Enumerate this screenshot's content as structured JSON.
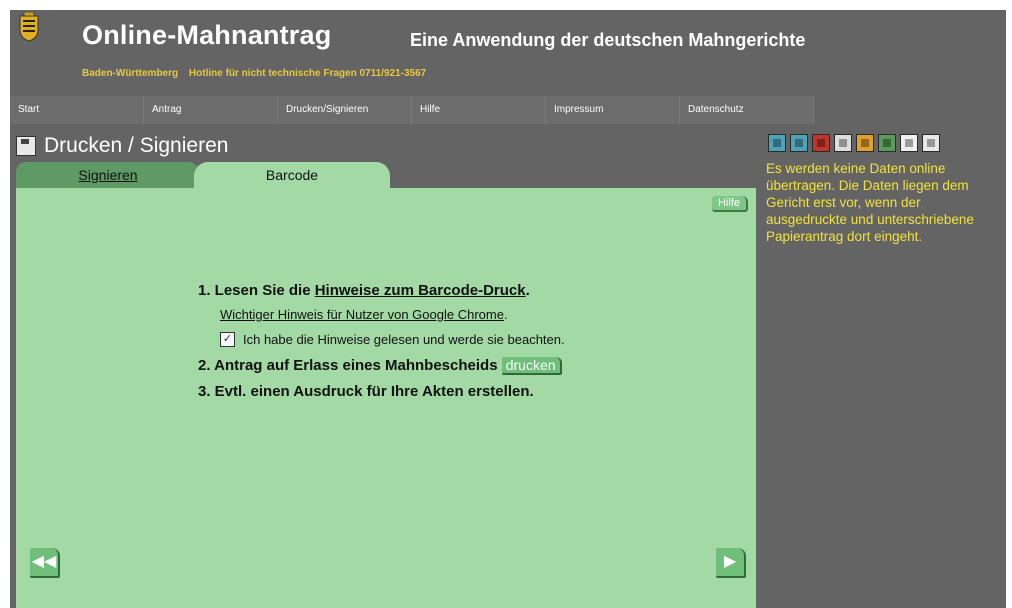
{
  "header": {
    "title": "Online-Mahnantrag",
    "subtitle": "Eine Anwendung der deutschen Mahngerichte",
    "region": "Baden-Württemberg",
    "hotline": "Hotline für nicht technische Fragen 0711/921-3567"
  },
  "nav": [
    "Start",
    "Antrag",
    "Drucken/Signieren",
    "Hilfe",
    "Impressum",
    "Datenschutz"
  ],
  "page": {
    "title": "Drucken / Signieren",
    "tabs": [
      "Signieren",
      "Barcode"
    ],
    "help_label": "Hilfe"
  },
  "steps": {
    "step1_prefix": "1. Lesen Sie die ",
    "step1_link": "Hinweise zum Barcode-Druck",
    "step1_suffix": ".",
    "chrome_link": "Wichtiger Hinweis für Nutzer von Google Chrome",
    "chrome_suffix": ".",
    "checkbox_label": "Ich habe die Hinweise gelesen und werde sie beachten.",
    "checkbox_checked": true,
    "step2_text": "2. Antrag auf Erlass eines Mahnbescheids",
    "step2_button": "drucken",
    "step3_text": "3. Evtl. einen Ausdruck für Ihre Akten erstellen."
  },
  "info_text": "Es werden keine Daten online übertragen. Die Daten liegen dem Gericht erst vor, wenn der ausgedruckte und unterschriebene Papierantrag dort eingeht.",
  "icons": [
    "people-icon",
    "person-blue-icon",
    "person-red-icon",
    "stamp-icon",
    "lock-icon",
    "list-icon",
    "page-icon",
    "save-icon"
  ],
  "nav_buttons": {
    "back": "◀◀",
    "next": "▶"
  },
  "colors": {
    "background": "#646464",
    "panel": "#a3d9a5",
    "accent_text": "#f2e23c",
    "hotline": "#e8c840"
  }
}
